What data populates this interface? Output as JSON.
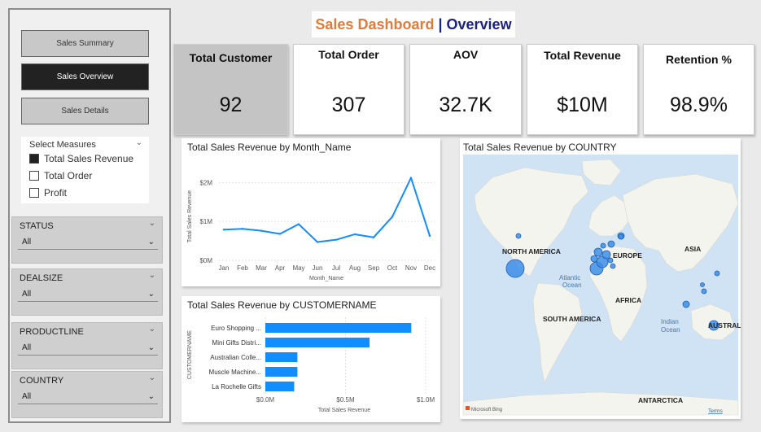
{
  "title": {
    "part1": "Sales Dashboard",
    "separator": "|",
    "part2": "Overview"
  },
  "nav": {
    "summary": "Sales Summary",
    "overview": "Sales Overview",
    "details": "Sales Details"
  },
  "measures": {
    "header": "Select Measures",
    "options": [
      {
        "label": "Total Sales Revenue",
        "checked": true
      },
      {
        "label": "Total Order",
        "checked": false
      },
      {
        "label": "Profit",
        "checked": false
      }
    ]
  },
  "slicers": [
    {
      "title": "STATUS",
      "value": "All"
    },
    {
      "title": "DEALSIZE",
      "value": "All"
    },
    {
      "title": "PRODUCTLINE",
      "value": "All"
    },
    {
      "title": "COUNTRY",
      "value": "All"
    }
  ],
  "kpis": [
    {
      "label": "Total Customer",
      "value": "92"
    },
    {
      "label": "Total Order",
      "value": "307"
    },
    {
      "label": "AOV",
      "value": "32.7K"
    },
    {
      "label": "Total Revenue",
      "value": "$10M"
    },
    {
      "label": "Retention %",
      "value": "98.9%"
    }
  ],
  "map": {
    "title": "Total Sales Revenue by COUNTRY",
    "labels": {
      "north_america": "NORTH AMERICA",
      "europe": "EUROPE",
      "asia": "ASIA",
      "atlantic": "Atlantic\nOcean",
      "africa": "AFRICA",
      "south_america": "SOUTH AMERICA",
      "indian": "Indian\nOcean",
      "australia": "AUSTRAL",
      "antarctica": "ANTARCTICA",
      "bing": "Microsoft Bing",
      "terms": "Terms"
    },
    "colors": {
      "water": "#cfe3f5",
      "land": "#f4f4ee",
      "bubble": "#3d8ee8"
    }
  },
  "chart_data": [
    {
      "type": "line",
      "title": "Total Sales Revenue by Month_Name",
      "xlabel": "Month_Name",
      "ylabel": "Total Sales Revenue",
      "categories": [
        "Jan",
        "Feb",
        "Mar",
        "Apr",
        "May",
        "Jun",
        "Jul",
        "Aug",
        "Sep",
        "Oct",
        "Nov",
        "Dec"
      ],
      "values": [
        0.79,
        0.81,
        0.76,
        0.68,
        0.93,
        0.47,
        0.53,
        0.67,
        0.59,
        1.12,
        2.12,
        0.63
      ],
      "unit": "M",
      "ylim": [
        0,
        2.3
      ],
      "yticks": [
        0,
        1,
        2
      ],
      "ytick_labels": [
        "$0M",
        "$1M",
        "$2M"
      ],
      "grid": true,
      "color": "#118dff"
    },
    {
      "type": "bar",
      "orientation": "horizontal",
      "title": "Total Sales Revenue by CUSTOMERNAME",
      "xlabel": "Total Sales Revenue",
      "ylabel": "CUSTOMERNAME",
      "categories": [
        "Euro Shopping ...",
        "Mini Gifts Distri...",
        "Australian Colle...",
        "Muscle Machine...",
        "La Rochelle Gifts"
      ],
      "values": [
        0.91,
        0.65,
        0.2,
        0.2,
        0.18
      ],
      "xlim": [
        0,
        1.0
      ],
      "xticks": [
        0,
        0.5,
        1.0
      ],
      "xtick_labels": [
        "$0.0M",
        "$0.5M",
        "$1.0M"
      ],
      "grid": true,
      "color": "#118dff"
    }
  ]
}
